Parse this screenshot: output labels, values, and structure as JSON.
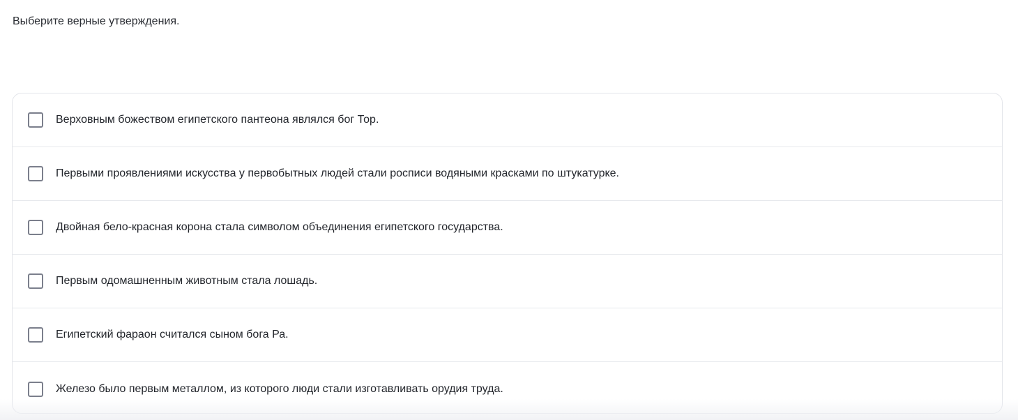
{
  "question": {
    "instruction": "Выберите верные утверждения."
  },
  "options": [
    {
      "label": "Верховным божеством египетского пантеона являлся бог Тор.",
      "checked": false
    },
    {
      "label": "Первыми проявлениями искусства у первобытных людей стали росписи водяными красками по штукатурке.",
      "checked": false
    },
    {
      "label": "Двойная бело-красная корона стала символом объединения египетского государства.",
      "checked": false
    },
    {
      "label": "Первым одомашненным животным стала лошадь.",
      "checked": false
    },
    {
      "label": "Египетский фараон считался сыном бога Ра.",
      "checked": false
    },
    {
      "label": "Железо было первым металлом, из которого люди стали изготавливать орудия труда.",
      "checked": false
    }
  ],
  "colors": {
    "text": "#23262c",
    "checkbox_border": "#7b7f8c",
    "divider": "#e6e8ec"
  }
}
